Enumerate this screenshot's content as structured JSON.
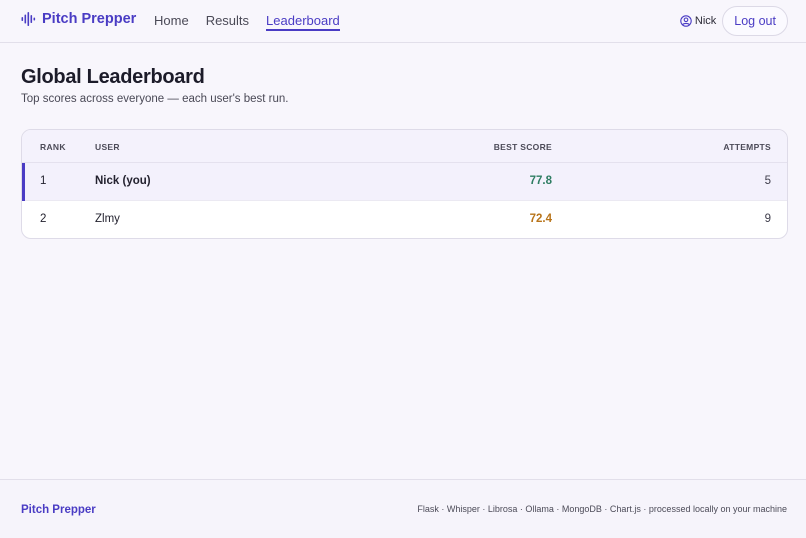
{
  "brand": {
    "name": "Pitch Prepper"
  },
  "nav": [
    {
      "label": "Home"
    },
    {
      "label": "Results"
    },
    {
      "label": "Leaderboard",
      "active": true
    }
  ],
  "user": {
    "name": "Nick",
    "logout_label": "Log out"
  },
  "page": {
    "title": "Global Leaderboard",
    "subtitle": "Top scores across everyone — each user's best run."
  },
  "table": {
    "columns": {
      "rank": "RANK",
      "user": "USER",
      "best_score": "BEST SCORE",
      "attempts": "ATTEMPTS"
    },
    "rows": [
      {
        "rank": "1",
        "user": "Nick (you)",
        "best_score": "77.8",
        "attempts": "5",
        "score_color": "#2e7d62",
        "is_me": true
      },
      {
        "rank": "2",
        "user": "Zlmy",
        "best_score": "72.4",
        "attempts": "9",
        "score_color": "#b8741a",
        "is_me": false
      }
    ]
  },
  "footer": {
    "brand": "Pitch Prepper",
    "tech": "Flask · Whisper · Librosa · Ollama · MongoDB · Chart.js · processed locally on your machine"
  },
  "colors": {
    "accent": "#4a3cc4",
    "background": "#f8f6fc"
  }
}
